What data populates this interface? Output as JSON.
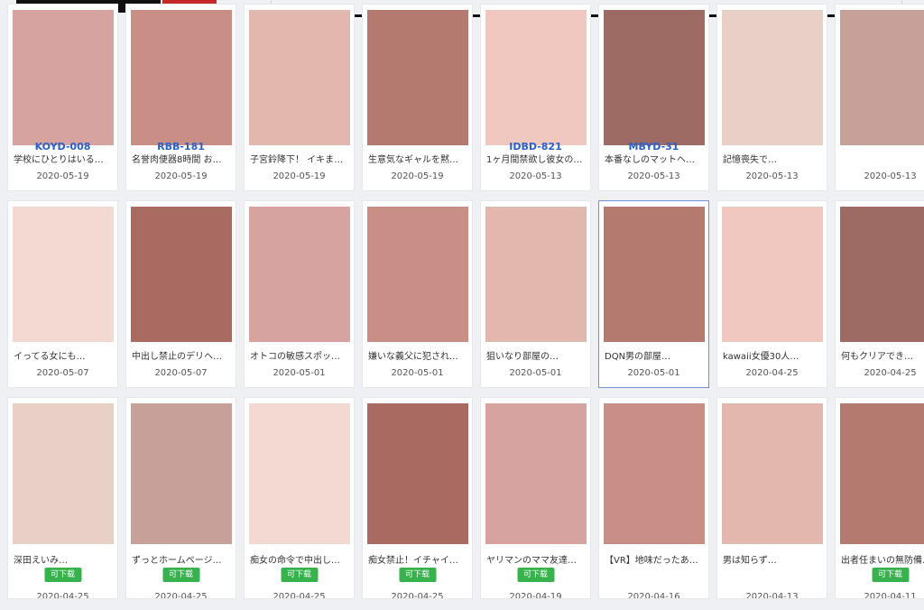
{
  "header": {
    "logo_text": ""
  },
  "download_label": "可下载",
  "items": [
    {
      "code": "KOYD-008",
      "title": "学校にひとりはいる童…",
      "date": "2020-05-19",
      "download": false
    },
    {
      "code": "RBB-181",
      "title": "名誉肉便器8時間 お前…",
      "date": "2020-05-19",
      "download": false
    },
    {
      "code": "",
      "title": "子宮鈴降下！ イキまく…",
      "date": "2020-05-19",
      "download": false
    },
    {
      "code": "",
      "title": "生意気なギャルを黙ら…",
      "date": "2020-05-19",
      "download": false
    },
    {
      "code": "IDBD-821",
      "title": "1ヶ月間禁欲し彼女のい…",
      "date": "2020-05-13",
      "download": false
    },
    {
      "code": "MBYD-31",
      "title": "本番なしのマットヘル…",
      "date": "2020-05-13",
      "download": false
    },
    {
      "code": "",
      "title": "記憶喪失で…",
      "date": "2020-05-13",
      "download": false
    },
    {
      "code": "",
      "title": "",
      "date": "2020-05-13",
      "download": false
    },
    {
      "code": "",
      "title": "イってる女にも…",
      "date": "2020-05-07",
      "download": false
    },
    {
      "code": "",
      "title": "中出し禁止のデリヘルで…",
      "date": "2020-05-07",
      "download": false
    },
    {
      "code": "",
      "title": "オトコの敏感スポット…",
      "date": "2020-05-01",
      "download": false
    },
    {
      "code": "",
      "title": "嫌いな義父に犯されても…",
      "date": "2020-05-01",
      "download": false
    },
    {
      "code": "",
      "title": "狙いなり部屋の…",
      "date": "2020-05-01",
      "download": false
    },
    {
      "code": "",
      "title": "DQN男の部屋…",
      "date": "2020-05-01",
      "download": false
    },
    {
      "code": "",
      "title": "kawaii女優30人…",
      "date": "2020-04-25",
      "download": false
    },
    {
      "code": "",
      "title": "何もクリアでき…",
      "date": "2020-04-25",
      "download": false
    },
    {
      "code": "",
      "title": "深田えいみ…",
      "date": "2020-04-25",
      "download": true
    },
    {
      "code": "",
      "title": "ずっとホームページで…",
      "date": "2020-04-25",
      "download": true
    },
    {
      "code": "",
      "title": "痴女の命令で中出しす…",
      "date": "2020-04-25",
      "download": true
    },
    {
      "code": "",
      "title": "痴女禁止！イチャイチ…",
      "date": "2020-04-25",
      "download": true
    },
    {
      "code": "",
      "title": "ヤリマンのママ友達も…",
      "date": "2020-04-19",
      "download": true
    },
    {
      "code": "",
      "title": "【VR】地味だったあの…",
      "date": "2020-04-16",
      "download": false
    },
    {
      "code": "",
      "title": "男は知らず…",
      "date": "2020-04-13",
      "download": false
    },
    {
      "code": "",
      "title": "出者任まいの無防備な…",
      "date": "2020-04-11",
      "download": true
    }
  ],
  "colors": {
    "accent": "#2a61c8",
    "download_bg": "#37b24d",
    "selected_border": "#6f8fd6"
  }
}
